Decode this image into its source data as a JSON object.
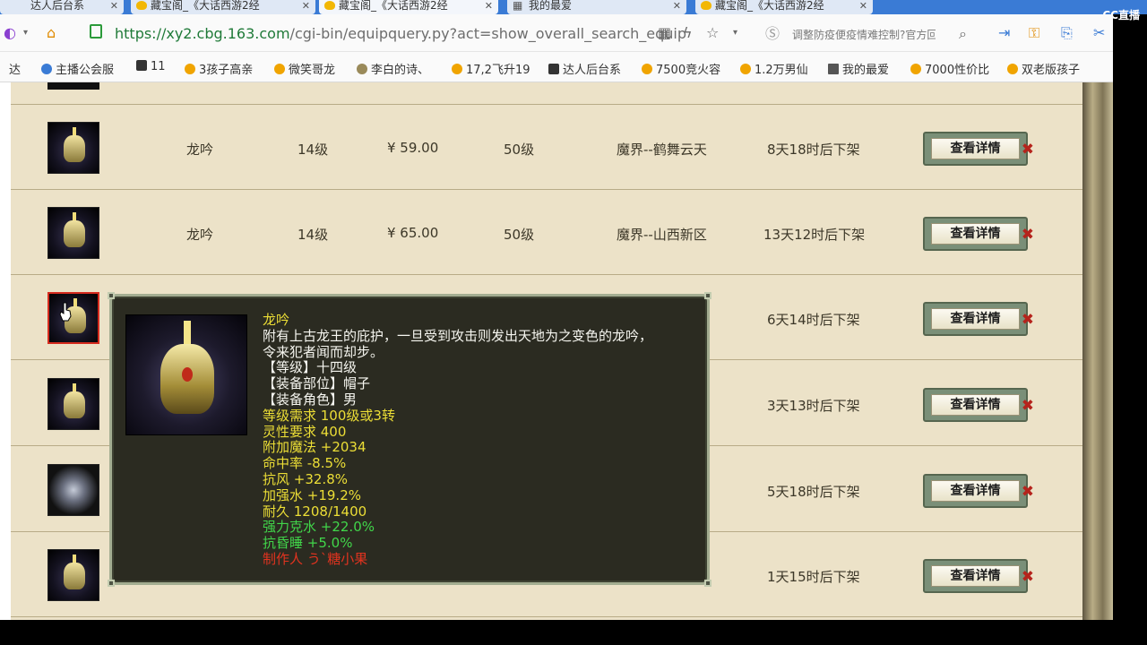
{
  "tabs": [
    {
      "label": "达人后台系"
    },
    {
      "label": "藏宝阁_《大话西游2经"
    },
    {
      "label": "藏宝阁_《大话西游2经"
    },
    {
      "label": "我的最爱"
    },
    {
      "label": "藏宝阁_《大话西游2经"
    }
  ],
  "address_bar": {
    "url_host": "https://xy2.cbg.163.com",
    "url_path": "/cgi-bin/equipquery.py?act=show_overall_search_equip"
  },
  "search_bar": {
    "text": "调整防疫便疫情难控制?官方回"
  },
  "bookmarks": [
    {
      "label": "达"
    },
    {
      "label": "主播公会服"
    },
    {
      "label": "11"
    },
    {
      "label": "3孩子高亲"
    },
    {
      "label": "微笑哥龙"
    },
    {
      "label": "李白的诗、"
    },
    {
      "label": "17,2飞升19"
    },
    {
      "label": "达人后台系"
    },
    {
      "label": "7500竞火容"
    },
    {
      "label": "1.2万男仙"
    },
    {
      "label": "我的最爱"
    },
    {
      "label": "7000性价比"
    },
    {
      "label": "双老版孩子"
    }
  ],
  "brand": {
    "cc_logo": "CC直播"
  },
  "list": {
    "button_label": "查看详情",
    "rows": [
      {
        "name": "龙吟",
        "level": "14级",
        "price": "¥ 59.00",
        "req": "50级",
        "server": "魔界--鹤舞云天",
        "time": "8天18时后下架"
      },
      {
        "name": "龙吟",
        "level": "14级",
        "price": "¥ 65.00",
        "req": "50级",
        "server": "魔界--山西新区",
        "time": "13天12时后下架"
      },
      {
        "name": "",
        "level": "",
        "price": "",
        "req": "",
        "server": "",
        "time": "6天14时后下架"
      },
      {
        "name": "",
        "level": "",
        "price": "",
        "req": "",
        "server": "",
        "time": "3天13时后下架"
      },
      {
        "name": "",
        "level": "",
        "price": "",
        "req": "",
        "server": "",
        "time": "5天18时后下架"
      },
      {
        "name": "",
        "level": "",
        "price": "",
        "req": "",
        "server": "",
        "time": "1天15时后下架"
      }
    ]
  },
  "tooltip": {
    "title": "龙吟",
    "desc1": "附有上古龙王的庇护，一旦受到攻击则发出天地为之变色的龙吟，",
    "desc2": "令来犯者闻而却步。",
    "grade": "【等级】十四级",
    "slot": "【装备部位】帽子",
    "role": "【装备角色】男",
    "level_req": "等级需求 100级或3转",
    "spirit_req": "灵性要求 400",
    "magic": "附加魔法 +2034",
    "hit": "命中率 -8.5%",
    "wind": "抗风 +32.8%",
    "water": "加强水 +19.2%",
    "durability": "耐久 1208/1400",
    "counter_water": "强力克水 +22.0%",
    "anti_sleep": "抗昏睡 +5.0%",
    "maker": "制作人 う`糖小果"
  }
}
